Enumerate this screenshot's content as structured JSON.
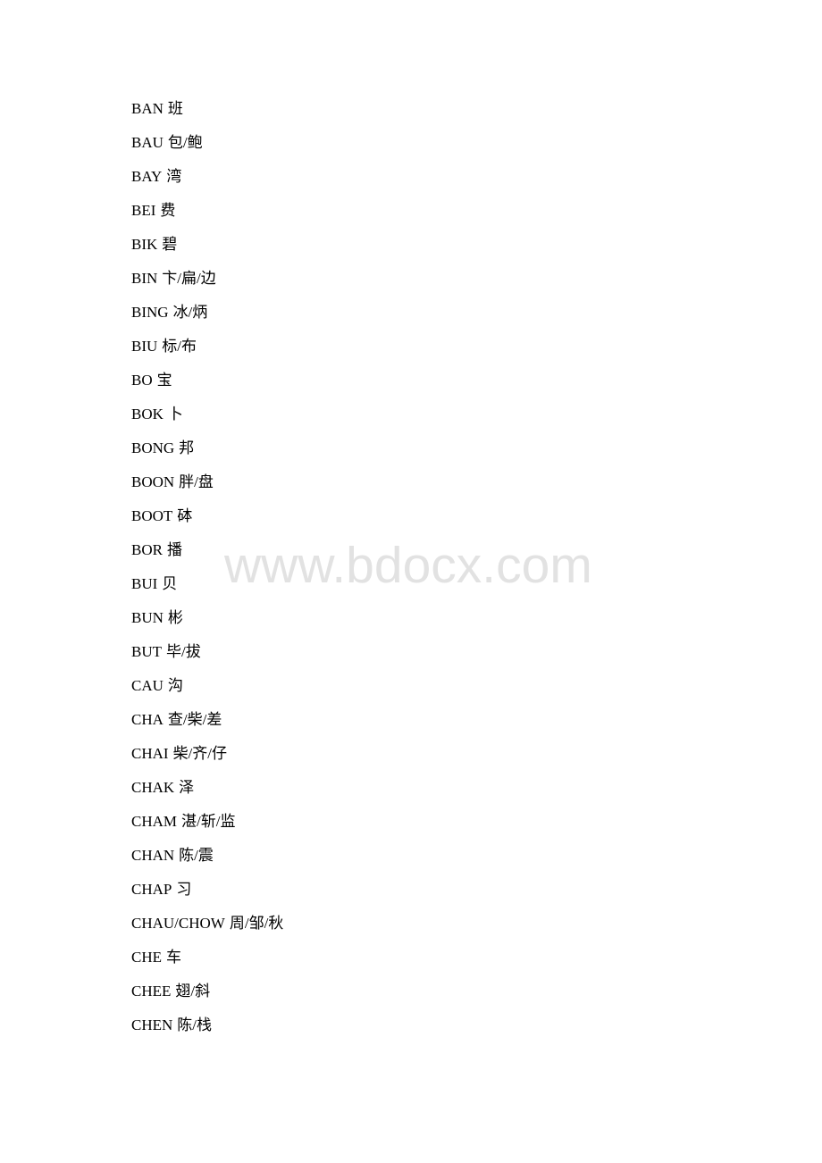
{
  "document": {
    "entries": [
      {
        "code": "BAN",
        "chars": "班"
      },
      {
        "code": "BAU",
        "chars": "包/鲍"
      },
      {
        "code": "BAY",
        "chars": "湾"
      },
      {
        "code": "BEI",
        "chars": "费"
      },
      {
        "code": "BIK",
        "chars": "碧"
      },
      {
        "code": "BIN",
        "chars": "卞/扁/边"
      },
      {
        "code": "BING",
        "chars": "冰/炳"
      },
      {
        "code": "BIU",
        "chars": "标/布"
      },
      {
        "code": "BO",
        "chars": "宝"
      },
      {
        "code": "BOK",
        "chars": "卜"
      },
      {
        "code": "BONG",
        "chars": "邦"
      },
      {
        "code": "BOON",
        "chars": "胖/盘"
      },
      {
        "code": "BOOT",
        "chars": "砵"
      },
      {
        "code": "BOR",
        "chars": "播"
      },
      {
        "code": "BUI",
        "chars": "贝"
      },
      {
        "code": "BUN",
        "chars": "彬"
      },
      {
        "code": "BUT",
        "chars": "毕/拔"
      },
      {
        "code": "CAU",
        "chars": "沟"
      },
      {
        "code": "CHA",
        "chars": "查/柴/差"
      },
      {
        "code": "CHAI",
        "chars": "柴/齐/仔"
      },
      {
        "code": "CHAK",
        "chars": "泽"
      },
      {
        "code": "CHAM",
        "chars": "湛/斩/监"
      },
      {
        "code": "CHAN",
        "chars": "陈/震"
      },
      {
        "code": "CHAP",
        "chars": "习"
      },
      {
        "code": "CHAU/CHOW",
        "chars": "周/邹/秋"
      },
      {
        "code": "CHE",
        "chars": "车"
      },
      {
        "code": "CHEE",
        "chars": "翅/斜"
      },
      {
        "code": "CHEN",
        "chars": "陈/栈"
      }
    ]
  },
  "watermark": {
    "text": "www.bdocx.com"
  }
}
